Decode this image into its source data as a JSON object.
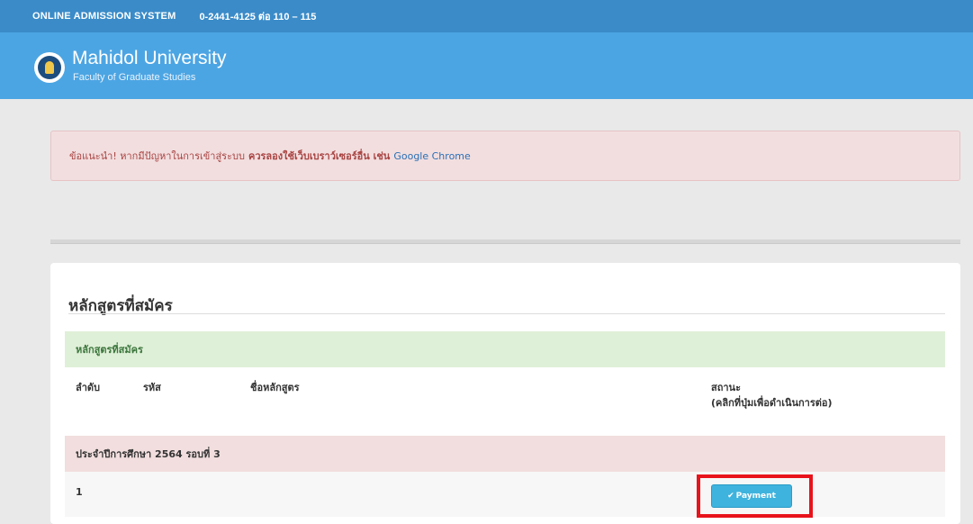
{
  "topbar": {
    "system_name": "ONLINE ADMISSION SYSTEM",
    "phone": "0-2441-4125 ต่อ 110 – 115"
  },
  "header": {
    "university": "Mahidol University",
    "faculty": "Faculty of Graduate Studies",
    "logo_icon": "mahidol-seal-icon"
  },
  "alert": {
    "prefix": "ข้อแนะนำ! หากมีปัญหาในการเข้าสู่ระบบ",
    "emphasis": "ควรลองใช้เว็บเบราว์เซอร์อื่น เช่น",
    "browser": "Google Chrome"
  },
  "courses": {
    "title": "หลักสูตรที่สมัคร",
    "panel_heading": "หลักสูตรที่สมัคร",
    "columns": {
      "order": "ลำดับ",
      "code": "รหัส",
      "name": "ชื่อหลักสูตร",
      "status_line1": "สถานะ",
      "status_line2": "(คลิกที่ปุ่มเพื่อดำเนินการต่อ)"
    },
    "group_label": "ประจำปีการศึกษา 2564 รอบที่ 3",
    "rows": [
      {
        "order": "1",
        "code": "",
        "name": "",
        "action_label": "Payment"
      }
    ]
  },
  "colors": {
    "topbar": "#3a8bc8",
    "header": "#4ca5e3",
    "highlight": "#e8131b",
    "button": "#3eb3dd"
  }
}
